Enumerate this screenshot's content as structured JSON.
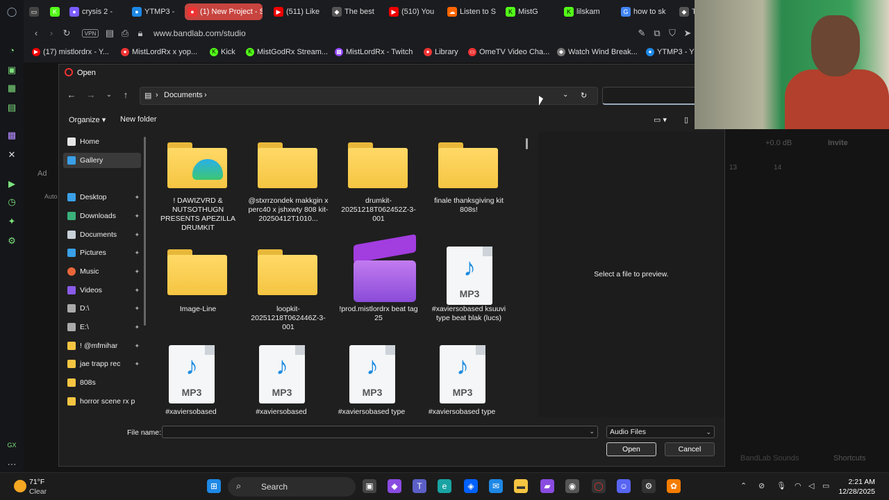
{
  "browser": {
    "url": "www.bandlab.com/studio",
    "tabs": [
      {
        "label": "crysis 2 -",
        "icon": "crysis-icon",
        "color": "#7b5cff"
      },
      {
        "label": "YTMP3 -",
        "icon": "ytmp3-icon",
        "color": "#1e88e5"
      },
      {
        "label": "(1) New Project - S",
        "icon": "bandlab-icon",
        "color": "#e33"
      },
      {
        "label": "(511) Like",
        "icon": "youtube-icon",
        "color": "#e00"
      },
      {
        "label": "The best",
        "icon": "site-icon",
        "color": "#555"
      },
      {
        "label": "(510) You",
        "icon": "youtube-icon",
        "color": "#e00"
      },
      {
        "label": "Listen to S",
        "icon": "soundcloud-icon",
        "color": "#f60"
      },
      {
        "label": "MistG",
        "icon": "kick-icon",
        "color": "#53fc18"
      },
      {
        "label": "lilskam",
        "icon": "kick-icon",
        "color": "#53fc18"
      },
      {
        "label": "how to sk",
        "icon": "google-icon",
        "color": "#4285f4"
      },
      {
        "label": "T",
        "icon": "site-icon",
        "color": "#555"
      }
    ],
    "bookmarks": [
      {
        "label": "(17) mistlordrx - Y...",
        "color": "#e00"
      },
      {
        "label": "MistLordRx x yop...",
        "color": "#e33"
      },
      {
        "label": "Kick",
        "color": "#53fc18"
      },
      {
        "label": "MistGodRx Stream...",
        "color": "#53fc18"
      },
      {
        "label": "MistLordRx - Twitch",
        "color": "#9146ff"
      },
      {
        "label": "Library",
        "color": "#e33"
      },
      {
        "label": "OmeTV Video Cha...",
        "color": "#e33"
      },
      {
        "label": "Watch Wind Break...",
        "color": "#777"
      },
      {
        "label": "YTMP3 - Y",
        "color": "#1e88e5"
      }
    ]
  },
  "bandlab": {
    "db_label": "+0.0 dB",
    "invite_label": "Invite",
    "ruler": [
      "13",
      "14"
    ],
    "sounds_label": "BandLab Sounds",
    "shortcuts_label": "Shortcuts",
    "add_label": "Ad",
    "auto_label": "Auto"
  },
  "dialog": {
    "title": "Open",
    "breadcrumb": [
      "Documents"
    ],
    "toolbar": {
      "organize": "Organize",
      "new_folder": "New folder"
    },
    "nav": [
      {
        "label": "Home",
        "icon": "home-icon",
        "color": "#e6e6e6",
        "pinned": false,
        "selected": false
      },
      {
        "label": "Gallery",
        "icon": "gallery-icon",
        "color": "#39a0e8",
        "pinned": false,
        "selected": true
      },
      {
        "label": "Desktop",
        "icon": "desktop-icon",
        "color": "#3aa0e8",
        "pinned": true,
        "selected": false
      },
      {
        "label": "Downloads",
        "icon": "downloads-icon",
        "color": "#3ab07a",
        "pinned": true,
        "selected": false
      },
      {
        "label": "Documents",
        "icon": "documents-icon",
        "color": "#c8d0d8",
        "pinned": true,
        "selected": false
      },
      {
        "label": "Pictures",
        "icon": "pictures-icon",
        "color": "#39a0e8",
        "pinned": true,
        "selected": false
      },
      {
        "label": "Music",
        "icon": "music-icon",
        "color": "#e8663a",
        "pinned": true,
        "selected": false
      },
      {
        "label": "Videos",
        "icon": "videos-icon",
        "color": "#8a5ae8",
        "pinned": true,
        "selected": false
      },
      {
        "label": "D:\\",
        "icon": "drive-icon",
        "color": "#aaa",
        "pinned": true,
        "selected": false
      },
      {
        "label": "E:\\",
        "icon": "drive-icon",
        "color": "#aaa",
        "pinned": true,
        "selected": false
      },
      {
        "label": "!  @mfmihar",
        "icon": "folder-icon",
        "color": "#f5c542",
        "pinned": true,
        "selected": false
      },
      {
        "label": "jae trapp rec",
        "icon": "folder-icon",
        "color": "#f5c542",
        "pinned": true,
        "selected": false
      },
      {
        "label": "808s",
        "icon": "folder-icon",
        "color": "#f5c542",
        "pinned": false,
        "selected": false
      },
      {
        "label": "horror scene rx p",
        "icon": "folder-icon",
        "color": "#f5c542",
        "pinned": false,
        "selected": false
      }
    ],
    "files": [
      {
        "name": "! DAWIZVRD & NUTSOTHUGN PRESENTS APEZILLA DRUMKIT",
        "kind": "edge-folder"
      },
      {
        "name": "@stxrrzondek makkgin x perc40 x jshxwty 808 kit-20250412T1010...",
        "kind": "folder"
      },
      {
        "name": "drumkit-20251218T062452Z-3-001",
        "kind": "folder"
      },
      {
        "name": "finale thanksgiving kit 808s!",
        "kind": "folder"
      },
      {
        "name": "Image-Line",
        "kind": "folder"
      },
      {
        "name": "loopkit-20251218T062446Z-3-001",
        "kind": "folder"
      },
      {
        "name": "!prod.mistlordrx beat tag 25",
        "kind": "clapper"
      },
      {
        "name": "#xaviersobased ksuuvi type beat  blak (lucs)",
        "kind": "mp3"
      },
      {
        "name": "#xaviersobased",
        "kind": "mp3"
      },
      {
        "name": "#xaviersobased",
        "kind": "mp3"
      },
      {
        "name": "#xaviersobased type",
        "kind": "mp3"
      },
      {
        "name": "#xaviersobased type",
        "kind": "mp3"
      }
    ],
    "mp3_label": "MP3",
    "preview_text": "Select a file to preview.",
    "file_name_label": "File name:",
    "file_name_value": "",
    "file_type": "Audio Files",
    "open_label": "Open",
    "cancel_label": "Cancel"
  },
  "taskbar": {
    "temp": "71°F",
    "condition": "Clear",
    "search_label": "Search",
    "time": "2:21 AM",
    "date": "12/28/2025"
  }
}
